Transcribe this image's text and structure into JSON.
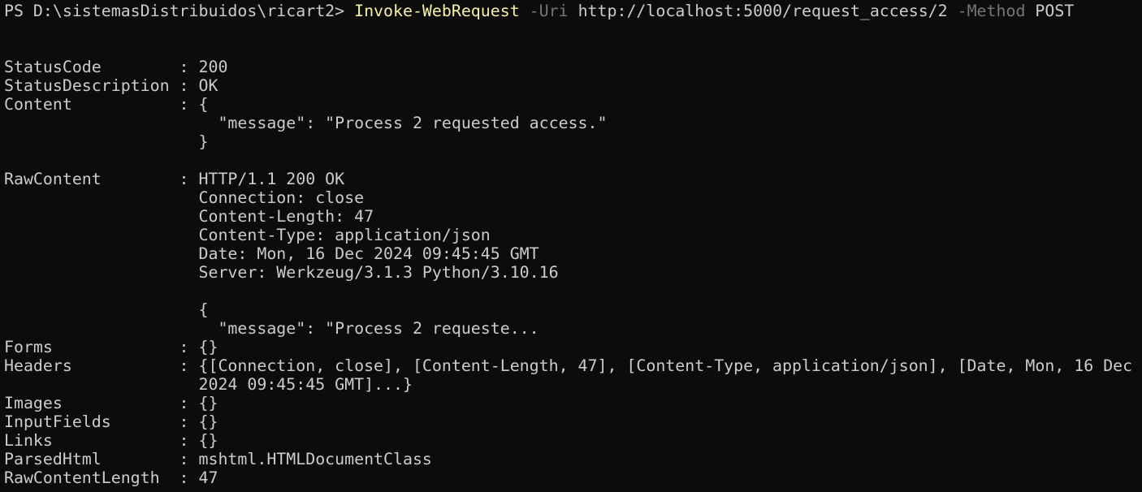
{
  "prompt": {
    "prefix": "PS D:\\sistemasDistribuidos\\ricart2> ",
    "command": "Invoke-WebRequest",
    "uri_flag": "-Uri",
    "uri_value": "http://localhost:5000/request_access/2",
    "method_flag": "-Method",
    "method_value": "POST"
  },
  "output_lines": [
    "",
    "",
    "StatusCode        : 200",
    "StatusDescription : OK",
    "Content           : {",
    "                      \"message\": \"Process 2 requested access.\"",
    "                    }",
    "",
    "RawContent        : HTTP/1.1 200 OK",
    "                    Connection: close",
    "                    Content-Length: 47",
    "                    Content-Type: application/json",
    "                    Date: Mon, 16 Dec 2024 09:45:45 GMT",
    "                    Server: Werkzeug/3.1.3 Python/3.10.16",
    "",
    "                    {",
    "                      \"message\": \"Process 2 requeste...",
    "Forms             : {}",
    "Headers           : {[Connection, close], [Content-Length, 47], [Content-Type, application/json], [Date, Mon, 16 Dec",
    "                    2024 09:45:45 GMT]...}",
    "Images            : {}",
    "InputFields       : {}",
    "Links             : {}",
    "ParsedHtml        : mshtml.HTMLDocumentClass",
    "RawContentLength  : 47"
  ],
  "colors": {
    "background": "#0c0c0c",
    "foreground": "#cccccc",
    "command": "#f9f1a5",
    "parameter": "#767676"
  }
}
